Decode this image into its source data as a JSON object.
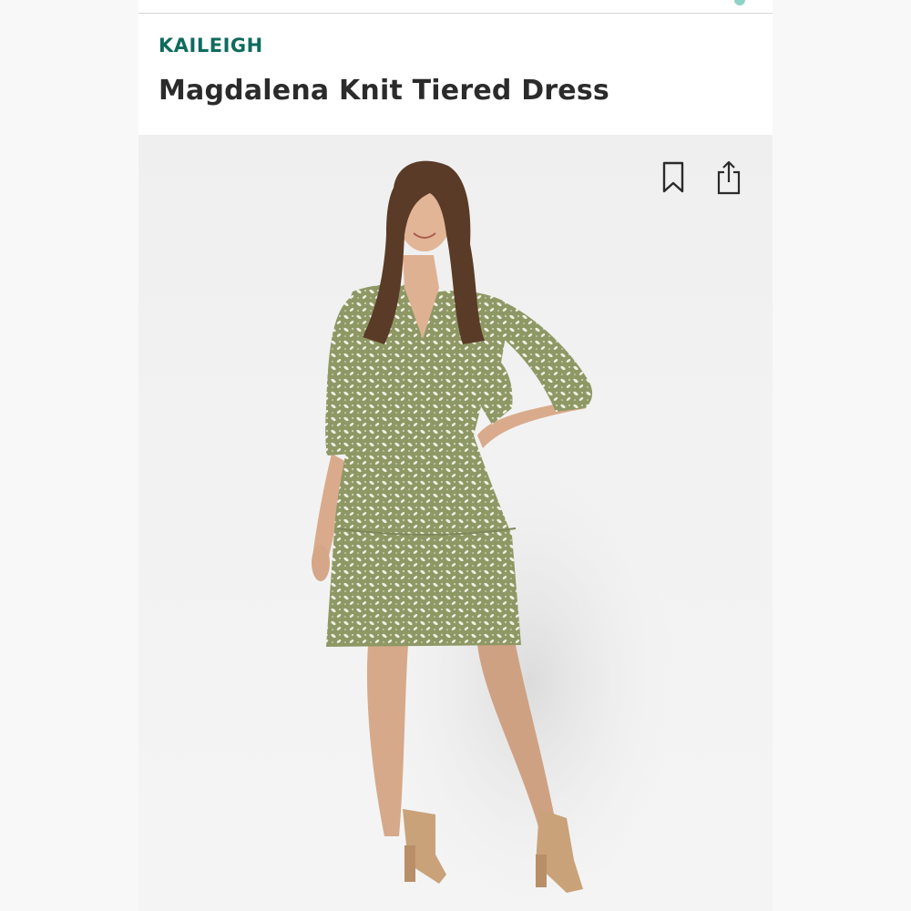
{
  "product": {
    "brand": "KAILEIGH",
    "name": "Magdalena Knit Tiered Dress"
  },
  "icons": {
    "bookmark": "bookmark-icon",
    "share": "share-icon"
  },
  "colors": {
    "brand_accent": "#0f6b5e",
    "title_text": "#2b2b2b",
    "dress_olive": "#8e9865"
  }
}
